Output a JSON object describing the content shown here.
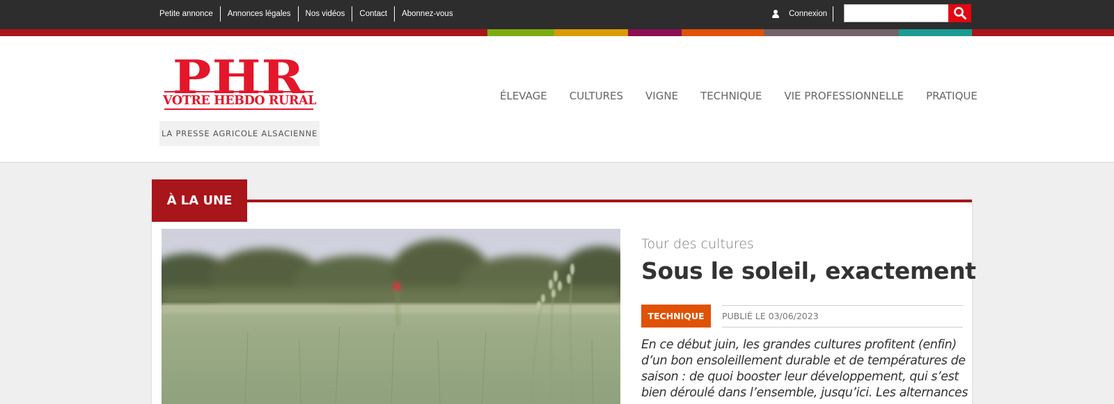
{
  "topbar": {
    "links": [
      "Petite annonce",
      "Annonces légales",
      "Nos vidéos",
      "Contact",
      "Abonnez-vous"
    ],
    "login_label": "Connexion",
    "search_placeholder": ""
  },
  "stripe_colors": {
    "base": "#a8151b",
    "segments": [
      "#7eab13",
      "#d99b06",
      "#8b0f55",
      "#e05206",
      "#75616a",
      "#1c9b93"
    ]
  },
  "header": {
    "logo_text": "PHR",
    "logo_subtitle": "VOTRE HEBDO RURAL",
    "tagline": "LA PRESSE AGRICOLE ALSACIENNE",
    "nav": [
      "ÉLEVAGE",
      "CULTURES",
      "VIGNE",
      "TECHNIQUE",
      "VIE PROFESSIONNELLE",
      "PRATIQUE"
    ]
  },
  "une": {
    "title": "À LA UNE",
    "article": {
      "kicker": "Tour des cultures",
      "headline": "Sous le soleil, exactement",
      "category": "TECHNIQUE",
      "published": "PUBLIÉ LE 03/06/2023",
      "chapo": "En ce début juin, les grandes cultures profitent (enfin) d’un bon ensoleillement durable et de températures de saison : de quoi booster leur développement, qui s’est bien déroulé dans l’ensemble, jusqu’ici. Les alternances"
    }
  },
  "colors": {
    "brand_red": "#e4162a",
    "dark_red": "#a8151b",
    "badge_orange": "#e05206",
    "topbar_bg": "#2d2d2d"
  }
}
